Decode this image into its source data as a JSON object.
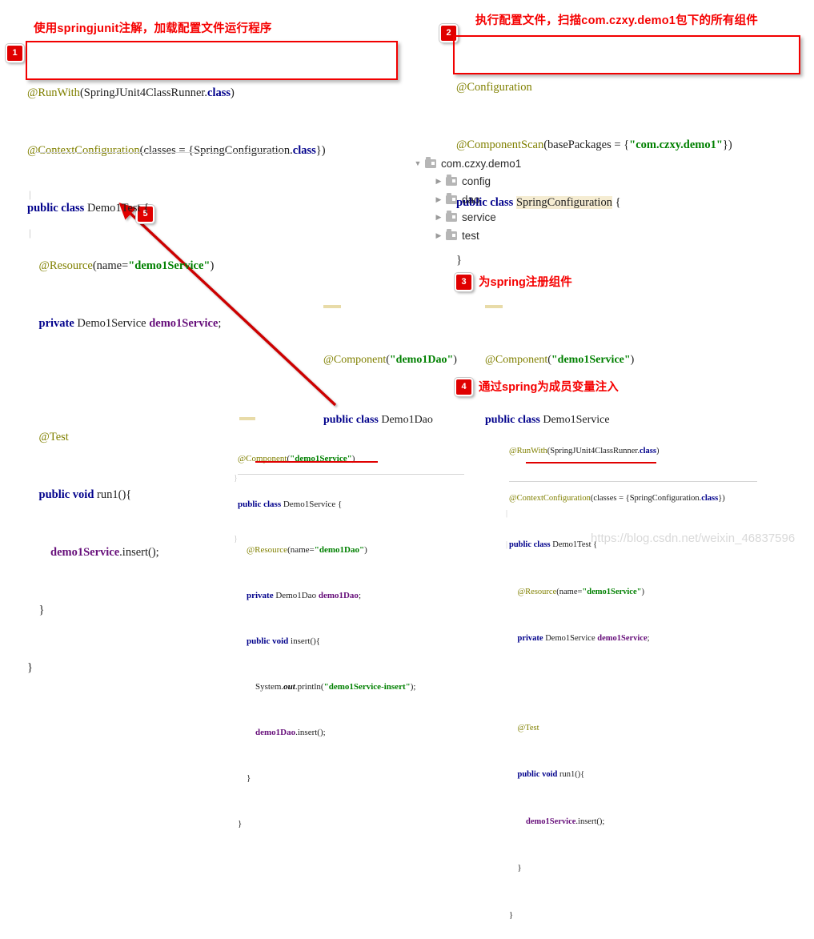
{
  "headings": {
    "step1": "使用springjunit注解，加载配置文件运行程序",
    "step2": "执行配置文件，扫描com.czxy.demo1包下的所有组件",
    "step3": "为spring注册组件",
    "step4": "通过spring为成员变量注入"
  },
  "badges": {
    "one": "1",
    "two": "2",
    "three": "3",
    "four": "4",
    "five": "5"
  },
  "code_main": {
    "line1_ann": "@RunWith",
    "line1_rest_a": "(SpringJUnit4ClassRunner.",
    "line1_kw": "class",
    "line1_rest_b": ")",
    "line2_ann": "@ContextConfiguration",
    "line2_rest_a": "(classes = {SpringConfiguration.",
    "line2_kw": "class",
    "line2_rest_b": "})",
    "line3_kw": "public class",
    "line3_rest": " Demo1Test {",
    "line4_ann": "@Resource",
    "line4_mid": "(name=",
    "line4_str": "\"demo1Service\"",
    "line4_end": ")",
    "line5_kw": "private",
    "line5_type": " Demo1Service ",
    "line5_fld": "demo1Service",
    "line5_end": ";",
    "line6_ann": "@Test",
    "line7_kw": "public void",
    "line7_rest": " run1(){",
    "line8_fld": "demo1Service",
    "line8_rest": ".insert();",
    "line9": "}",
    "line10": "}"
  },
  "code_config": {
    "line1_ann": "@Configuration",
    "line2_ann": "@ComponentScan",
    "line2_mid": "(basePackages = {",
    "line2_str": "\"com.czxy.demo1\"",
    "line2_end": "})",
    "line3_kw": "public class",
    "line3_cls": "SpringConfiguration",
    "line3_end": " {",
    "line4": "}"
  },
  "tree": {
    "items": [
      {
        "label": "com.czxy.demo1",
        "expanded": true,
        "level": 1
      },
      {
        "label": "config",
        "expanded": false,
        "level": 2
      },
      {
        "label": "dao",
        "expanded": false,
        "level": 2
      },
      {
        "label": "service",
        "expanded": false,
        "level": 2
      },
      {
        "label": "test",
        "expanded": false,
        "level": 2
      }
    ],
    "icons": {
      "expanded": "▼",
      "collapsed": "▶",
      "folder": "folder-icon"
    }
  },
  "code_dao": {
    "line1_ann": "@Component",
    "line1_mid": "(",
    "line1_str": "\"demo1Dao\"",
    "line1_end": ")",
    "line2_kw": "public class",
    "line2_rest": " Demo1Dao"
  },
  "code_service_small": {
    "line1_ann": "@Component",
    "line1_mid": "(",
    "line1_str": "\"demo1Service\"",
    "line1_end": ")",
    "line2_kw": "public class",
    "line2_rest": " Demo1Service"
  },
  "code_service_full": {
    "line1_ann": "@Component",
    "line1_mid": "(",
    "line1_str": "\"demo1Service\"",
    "line1_end": ")",
    "line2_kw": "public class",
    "line2_rest": " Demo1Service {",
    "line3_ann": "@Resource",
    "line3_mid": "(name=",
    "line3_str": "\"demo1Dao\"",
    "line3_end": ")",
    "line4_kw": "private",
    "line4_type": " Demo1Dao ",
    "line4_fld": "demo1Dao",
    "line4_end": ";",
    "line5_kw": "public void",
    "line5_rest": " insert(){",
    "line6_a": "System.",
    "line6_stat": "out",
    "line6_b": ".println(",
    "line6_str": "\"demo1Service-insert\"",
    "line6_c": ");",
    "line7_fld": "demo1Dao",
    "line7_rest": ".insert();",
    "line8": "}",
    "line9": "}"
  },
  "code_test_full": {
    "line1_ann": "@RunWith",
    "line1_a": "(SpringJUnit4ClassRunner.",
    "line1_kw": "class",
    "line1_b": ")",
    "line2_ann": "@ContextConfiguration",
    "line2_a": "(classes = {SpringConfiguration.",
    "line2_kw": "class",
    "line2_b": "})",
    "line3_kw": "public class",
    "line3_rest": " Demo1Test {",
    "line4_ann": "@Resource",
    "line4_mid": "(name=",
    "line4_str": "\"demo1Service\"",
    "line4_end": ")",
    "line5_kw": "private",
    "line5_type": " Demo1Service ",
    "line5_fld": "demo1Service",
    "line5_end": ";",
    "line6_ann": "@Test",
    "line7_kw": "public void",
    "line7_rest": " run1(){",
    "line8_fld": "demo1Service",
    "line8_rest": ".insert();",
    "line9": "}",
    "line10": "}"
  },
  "watermark": "https://blog.csdn.net/weixin_46837596",
  "colors": {
    "accent_red": "#f20000",
    "badge_red": "#e00000",
    "keyword": "#00008b",
    "annotation": "#808000",
    "string": "#008000",
    "field": "#660e7a",
    "highlight": "#f5ecd2",
    "tree_text": "#2b2b2b",
    "watermark": "#d9d9d9"
  }
}
